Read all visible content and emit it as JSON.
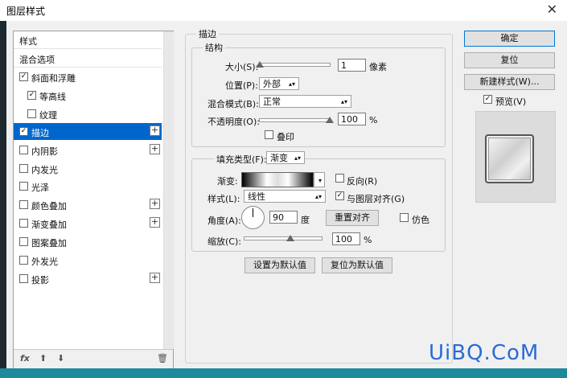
{
  "window": {
    "title": "图层样式",
    "close_glyph": "✕"
  },
  "left_panel": {
    "items": [
      {
        "label": "样式",
        "checkbox": false,
        "checked": false,
        "plus": false,
        "indent": false,
        "selected": false
      },
      {
        "label": "混合选项",
        "checkbox": false,
        "checked": false,
        "plus": false,
        "indent": false,
        "selected": false
      },
      {
        "label": "斜面和浮雕",
        "checkbox": true,
        "checked": true,
        "plus": false,
        "indent": false,
        "selected": false
      },
      {
        "label": "等高线",
        "checkbox": true,
        "checked": true,
        "plus": false,
        "indent": true,
        "selected": false
      },
      {
        "label": "纹理",
        "checkbox": true,
        "checked": false,
        "plus": false,
        "indent": true,
        "selected": false
      },
      {
        "label": "描边",
        "checkbox": true,
        "checked": true,
        "plus": true,
        "indent": false,
        "selected": true
      },
      {
        "label": "内阴影",
        "checkbox": true,
        "checked": false,
        "plus": true,
        "indent": false,
        "selected": false
      },
      {
        "label": "内发光",
        "checkbox": true,
        "checked": false,
        "plus": false,
        "indent": false,
        "selected": false
      },
      {
        "label": "光泽",
        "checkbox": true,
        "checked": false,
        "plus": false,
        "indent": false,
        "selected": false
      },
      {
        "label": "颜色叠加",
        "checkbox": true,
        "checked": false,
        "plus": true,
        "indent": false,
        "selected": false
      },
      {
        "label": "渐变叠加",
        "checkbox": true,
        "checked": false,
        "plus": true,
        "indent": false,
        "selected": false
      },
      {
        "label": "图案叠加",
        "checkbox": true,
        "checked": false,
        "plus": false,
        "indent": false,
        "selected": false
      },
      {
        "label": "外发光",
        "checkbox": true,
        "checked": false,
        "plus": false,
        "indent": false,
        "selected": false
      },
      {
        "label": "投影",
        "checkbox": true,
        "checked": false,
        "plus": true,
        "indent": false,
        "selected": false
      }
    ],
    "bottom_icons": {
      "fx": "fx",
      "up": "⬆",
      "down": "⬇",
      "trash": "🗑"
    }
  },
  "stroke": {
    "section_title": "描边",
    "structure_title": "结构",
    "size_label": "大小(S):",
    "size_value": "1",
    "size_unit": "像素",
    "position_label": "位置(P):",
    "position_value": "外部",
    "blend_label": "混合模式(B):",
    "blend_value": "正常",
    "opacity_label": "不透明度(O):",
    "opacity_value": "100",
    "opacity_unit": "%",
    "overprint_label": "叠印",
    "fill_type_label": "填充类型(F):",
    "fill_type_value": "渐变",
    "gradient_label": "渐变:",
    "reverse_label": "反向(R)",
    "style_label": "样式(L):",
    "style_value": "线性",
    "align_label": "与图层对齐(G)",
    "angle_label": "角度(A):",
    "angle_value": "90",
    "angle_unit": "度",
    "reset_align_label": "重置对齐",
    "dither_label": "仿色",
    "scale_label": "缩放(C):",
    "scale_value": "100",
    "scale_unit": "%",
    "set_default_label": "设置为默认值",
    "reset_default_label": "复位为默认值"
  },
  "right_panel": {
    "ok_label": "确定",
    "reset_label": "复位",
    "new_style_label": "新建样式(W)...",
    "preview_label": "预览(V)"
  },
  "watermark": "UiBQ.CoM"
}
